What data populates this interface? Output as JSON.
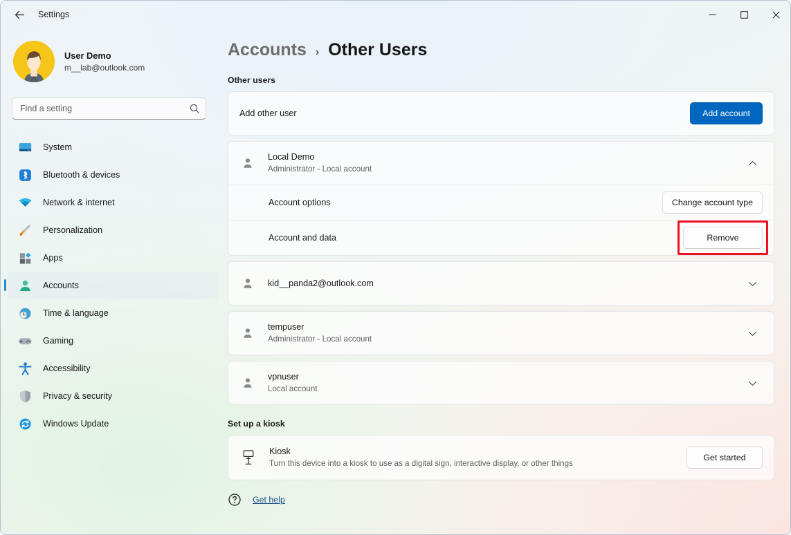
{
  "window": {
    "title": "Settings",
    "back_icon": "back-arrow-icon",
    "minimize_label": "─",
    "maximize_label": "□",
    "close_label": "✕"
  },
  "profile": {
    "name": "User Demo",
    "email": "m__lab@outlook.com",
    "avatar_color": "#f5c518"
  },
  "search": {
    "placeholder": "Find a setting",
    "value": "",
    "icon": "search-icon"
  },
  "sidebar": {
    "items": [
      {
        "label": "System",
        "icon": "monitor-icon",
        "active": false
      },
      {
        "label": "Bluetooth & devices",
        "icon": "bluetooth-icon",
        "active": false
      },
      {
        "label": "Network & internet",
        "icon": "wifi-icon",
        "active": false
      },
      {
        "label": "Personalization",
        "icon": "paintbrush-icon",
        "active": false
      },
      {
        "label": "Apps",
        "icon": "apps-icon",
        "active": false
      },
      {
        "label": "Accounts",
        "icon": "person-icon",
        "active": true
      },
      {
        "label": "Time & language",
        "icon": "clock-globe-icon",
        "active": false
      },
      {
        "label": "Gaming",
        "icon": "gamepad-icon",
        "active": false
      },
      {
        "label": "Accessibility",
        "icon": "accessibility-icon",
        "active": false
      },
      {
        "label": "Privacy & security",
        "icon": "shield-icon",
        "active": false
      },
      {
        "label": "Windows Update",
        "icon": "refresh-icon",
        "active": false
      }
    ]
  },
  "breadcrumb": {
    "parent": "Accounts",
    "separator": "›",
    "current": "Other Users"
  },
  "other_users": {
    "heading": "Other users",
    "add_other_user": {
      "label": "Add other user",
      "button_label": "Add account",
      "button_color": "#0067c0"
    },
    "accounts": [
      {
        "name": "Local Demo",
        "detail": "Administrator - Local account",
        "expanded": true,
        "chevron": "chevron-up-icon",
        "options": [
          {
            "label": "Account options",
            "button_label": "Change account type",
            "highlighted": false
          },
          {
            "label": "Account and data",
            "button_label": "Remove",
            "highlighted": true
          }
        ]
      },
      {
        "name": "kid__panda2@outlook.com",
        "detail": "",
        "expanded": false,
        "chevron": "chevron-down-icon",
        "options": []
      },
      {
        "name": "tempuser",
        "detail": "Administrator - Local account",
        "expanded": false,
        "chevron": "chevron-down-icon",
        "options": []
      },
      {
        "name": "vpnuser",
        "detail": "Local account",
        "expanded": false,
        "chevron": "chevron-down-icon",
        "options": []
      }
    ]
  },
  "kiosk": {
    "heading": "Set up a kiosk",
    "title": "Kiosk",
    "description": "Turn this device into a kiosk to use as a digital sign, interactive display, or other things",
    "button_label": "Get started",
    "icon": "kiosk-icon"
  },
  "footer": {
    "help_label": "Get help",
    "help_icon": "help-icon"
  },
  "highlight_color": "#ee1122"
}
